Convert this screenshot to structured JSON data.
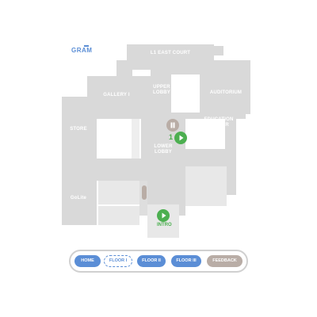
{
  "logo": {
    "text": "GRAM"
  },
  "map": {
    "rooms": {
      "l1_east_court": "L1 EAST COURT",
      "gallery_i": "GALLERY I",
      "upper_lobby": "UPPER\nLOBBY",
      "auditorium": "AUDITORIUM",
      "store": "STORE",
      "education_center": "EDUCATION\nCENTER",
      "lower_lobby": "LOWER\nLOBBY",
      "golite": "GoLite"
    },
    "markers": {
      "stop_1_number": "1",
      "intro_label": "INTRO"
    }
  },
  "nav": {
    "home": "HOME",
    "floor_i": "FLOOR I",
    "floor_ii": "FLOOR II",
    "floor_iii": "FLOOR III",
    "feedback": "FEEDBACK"
  },
  "colors": {
    "accent_blue": "#5b8ed6",
    "marker_green": "#4caf50",
    "marker_tan": "#b9ada6",
    "room_gray": "#d9d9d9"
  },
  "icons": [
    "play-icon",
    "pause-icon",
    "elevator-icon"
  ]
}
